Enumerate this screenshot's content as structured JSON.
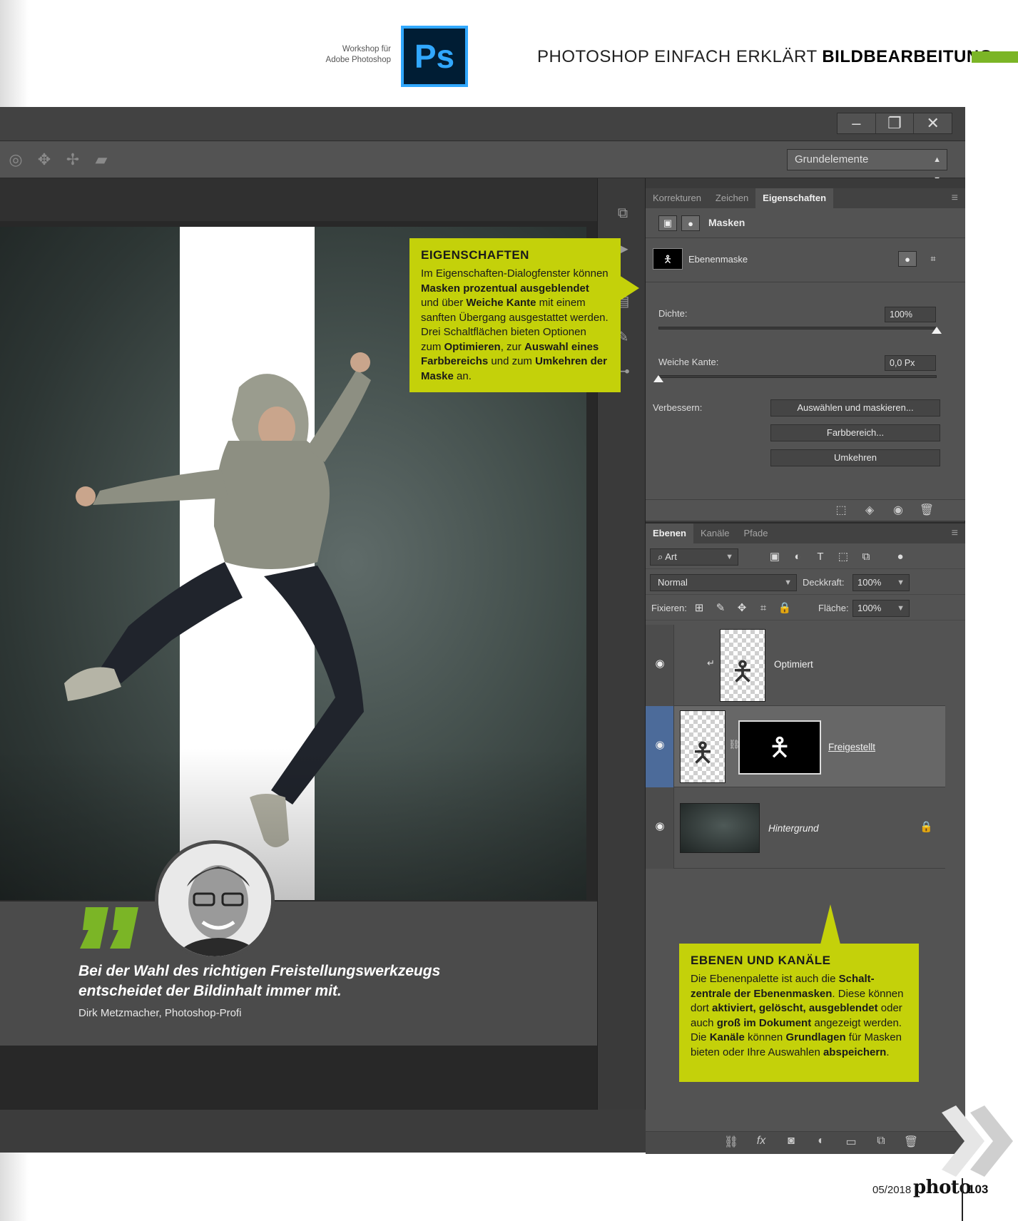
{
  "header": {
    "workshop_line1": "Workshop für",
    "workshop_line2": "Adobe Photoshop",
    "logo_text": "Ps",
    "title_regular": "PHOTOSHOP EINFACH ERKLÄRT",
    "title_bold": "BILDBEARBEITUNG"
  },
  "window": {
    "minimize": "–",
    "restore": "❐",
    "close": "✕",
    "workspace_select": "Grundelemente"
  },
  "properties_panel": {
    "tabs": [
      "Korrekturen",
      "Zeichen",
      "Eigenschaften"
    ],
    "active_tab": "Eigenschaften",
    "section_title": "Masken",
    "mask_label": "Ebenenmaske",
    "density_label": "Dichte:",
    "density_value": "100%",
    "density_level": 1.0,
    "feather_label": "Weiche Kante:",
    "feather_value": "0,0 Px",
    "feather_level": 0.0,
    "refine_label": "Verbessern:",
    "buttons": [
      "Auswählen und maskieren...",
      "Farbbereich...",
      "Umkehren"
    ]
  },
  "layers_panel": {
    "tabs": [
      "Ebenen",
      "Kanäle",
      "Pfade"
    ],
    "active_tab": "Ebenen",
    "filter_value": "Art",
    "blend_mode": "Normal",
    "opacity_label": "Deckkraft:",
    "opacity_value": "100%",
    "lock_label": "Fixieren:",
    "fill_label": "Fläche:",
    "fill_value": "100%",
    "layers": [
      {
        "name": "Optimiert",
        "visible": true,
        "selected": false
      },
      {
        "name": "Freigestellt",
        "visible": true,
        "selected": true
      },
      {
        "name": "Hintergrund",
        "visible": true,
        "selected": false,
        "locked": true
      }
    ]
  },
  "callout_properties": {
    "title": "EIGENSCHAFTEN",
    "p1": "Im Eigenschaften-Dialogfenster können ",
    "b1": "Masken prozentual aus­geblendet",
    "p2": " und über ",
    "b2": "Weiche Kante",
    "p3": " mit einem sanften Übergang ausge­stattet werden. Drei Schaltflächen bieten Optionen zum ",
    "b3": "Optimieren",
    "p4": ", zur ",
    "b4": "Auswahl eines Farbbereichs",
    "p5": " und zum ",
    "b5": "Umkehren der Maske",
    "p6": " an."
  },
  "callout_layers": {
    "title": "EBENEN UND KANÄLE",
    "p1": "Die Ebenenpalette ist auch die ",
    "b1": "Schalt­zentrale der Ebenenmasken",
    "p2": ". Diese kön­nen dort ",
    "b2": "aktiviert, gelöscht, ausgeblen­det",
    "p3": " oder auch ",
    "b3": "groß im Dokument",
    "p4": " angezeigt werden. Die ",
    "b4": "Kanäle",
    "p5": " können ",
    "b5": "Grundlagen",
    "p6": " für Masken bieten oder Ihre Auswahlen ",
    "b6": "abspeichern",
    "p7": "."
  },
  "quote": {
    "text": "Bei der Wahl des richtigen Freistellungswerkzeugs entscheidet der Bildinhalt immer mit.",
    "author": "Dirk Metzmacher, Photoshop-Profi"
  },
  "footer": {
    "issue": "05/2018",
    "brand": "photo",
    "page_number": "103"
  },
  "colors": {
    "accent_green": "#7bb526",
    "callout_yellow": "#c4d10a",
    "ps_blue": "#31a8ff",
    "selection_blue": "#4c6b9a"
  }
}
